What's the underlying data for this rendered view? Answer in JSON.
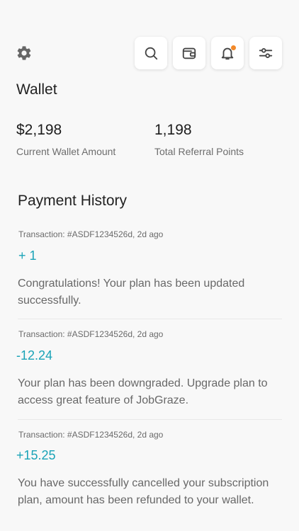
{
  "header": {
    "icons": [
      "gear-icon",
      "search-icon",
      "wallet-icon",
      "bell-icon",
      "sliders-icon"
    ],
    "notification_dot_color": "#f2892a"
  },
  "page": {
    "title": "Wallet"
  },
  "stats": {
    "wallet_amount": "$2,198",
    "wallet_label": "Current Wallet Amount",
    "referral_points": "1,198",
    "referral_label": "Total Referral Points"
  },
  "history": {
    "title": "Payment History",
    "items": [
      {
        "meta": "Transaction: #ASDF1234526d, 2d ago",
        "amount": "+ 1",
        "message": "Congratulations! Your plan has been updated successfully."
      },
      {
        "meta": "Transaction: #ASDF1234526d, 2d ago",
        "amount": "-12.24",
        "message": "Your plan has been downgraded. Upgrade plan to access great feature of JobGraze."
      },
      {
        "meta": "Transaction: #ASDF1234526d, 2d ago",
        "amount": "+15.25",
        "message": "You have successfully cancelled your subscription plan, amount has been refunded to your wallet."
      }
    ]
  },
  "colors": {
    "accent": "#1aa3b7",
    "background": "#f8f8f8"
  }
}
